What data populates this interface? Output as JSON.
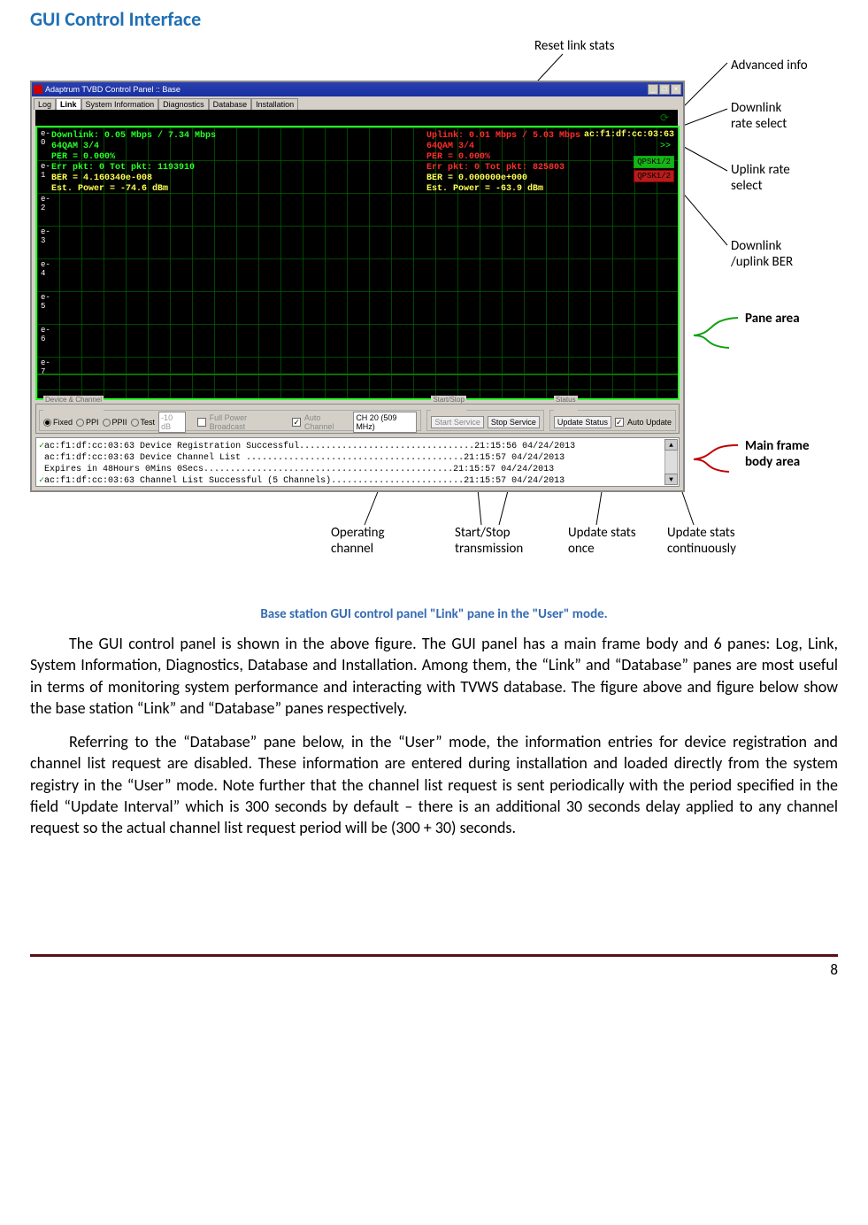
{
  "title": "GUI Control Interface",
  "caption": "Base station GUI control panel \"Link\" pane in the \"User\" mode.",
  "page_number": "8",
  "callouts": {
    "reset": "Reset link stats",
    "adv": "Advanced info",
    "dlrate": "Downlink rate select",
    "ulrate": "Uplink rate select",
    "ber": "Downlink /uplink BER",
    "pane": "Pane area",
    "main": "Main frame body area",
    "opch": "Operating channel",
    "startstop": "Start/Stop transmission",
    "updonce": "Update stats once",
    "updcont": "Update stats continuously"
  },
  "window": {
    "title": "Adaptrum TVBD Control Panel :: Base",
    "tabs": [
      "Log",
      "Link",
      "System Information",
      "Diagnostics",
      "Database",
      "Installation"
    ],
    "active_tab": "Link",
    "ylabels": [
      "e-0",
      "e-1",
      "e-2",
      "e-3",
      "e-4",
      "e-5",
      "e-6",
      "e-7"
    ],
    "mac": "ac:f1:df:cc:03:63",
    "adv_arrow": ">>",
    "rate_dl": "QPSK1/2",
    "rate_ul": "QPSK1/2",
    "downlink": {
      "line1": "Downlink:  0.05 Mbps / 7.34 Mbps",
      "mod": "64QAM  3/4",
      "per": "PER = 0.000%",
      "err": "Err pkt: 0 Tot pkt: 1193910",
      "ber": "BER = 4.160340e-008",
      "pow": "Est. Power = -74.6 dBm"
    },
    "uplink": {
      "line1": "Uplink: 0.01 Mbps / 5.03 Mbps",
      "mod": "64QAM  3/4",
      "per": "PER = 0.000%",
      "err": "Err pkt: 0 Tot pkt: 825803",
      "ber": "BER = 0.000000e+000",
      "pow": "Est. Power = -63.9 dBm"
    },
    "controls": {
      "group1_label": "Device & Channel",
      "radios": [
        "Fixed",
        "PPI",
        "PPII",
        "Test"
      ],
      "atten": "-10 dB",
      "full_power": "Full Power Broadcast",
      "auto_channel": "Auto Channel",
      "channel": "CH 20 (509 MHz)",
      "group2_label": "Start/Stop",
      "start": "Start Service",
      "stop": "Stop Service",
      "group3_label": "Status",
      "update": "Update Status",
      "auto_update": "Auto Update"
    },
    "log": [
      "ac:f1:df:cc:03:63 Device Registration Successful.................................21:15:56  04/24/2013",
      "ac:f1:df:cc:03:63 Device Channel List .........................................21:15:57  04/24/2013",
      "Expires in 48Hours 0Mins 0Secs...............................................21:15:57  04/24/2013",
      "ac:f1:df:cc:03:63 Channel List Successful (5 Channels).........................21:15:57  04/24/2013"
    ]
  },
  "paras": {
    "p1": "The GUI control panel is shown in the above figure. The GUI panel has a main frame body and 6 panes: Log, Link, System Information, Diagnostics, Database and Installation. Among them, the “Link” and “Database” panes are most useful in terms of monitoring system performance and interacting with TVWS database. The figure above and figure below show the base station “Link” and “Database” panes respectively.",
    "p2": "Referring to the “Database” pane below, in the “User” mode, the information entries for device registration and channel list request are disabled. These information are entered during installation and loaded directly from the system registry in the “User” mode. Note further that the channel list request is sent periodically with the period specified in the field “Update Interval” which is 300 seconds by default – there is an additional 30 seconds delay applied to any channel request so the actual channel list request period will be (300 + 30) seconds."
  }
}
